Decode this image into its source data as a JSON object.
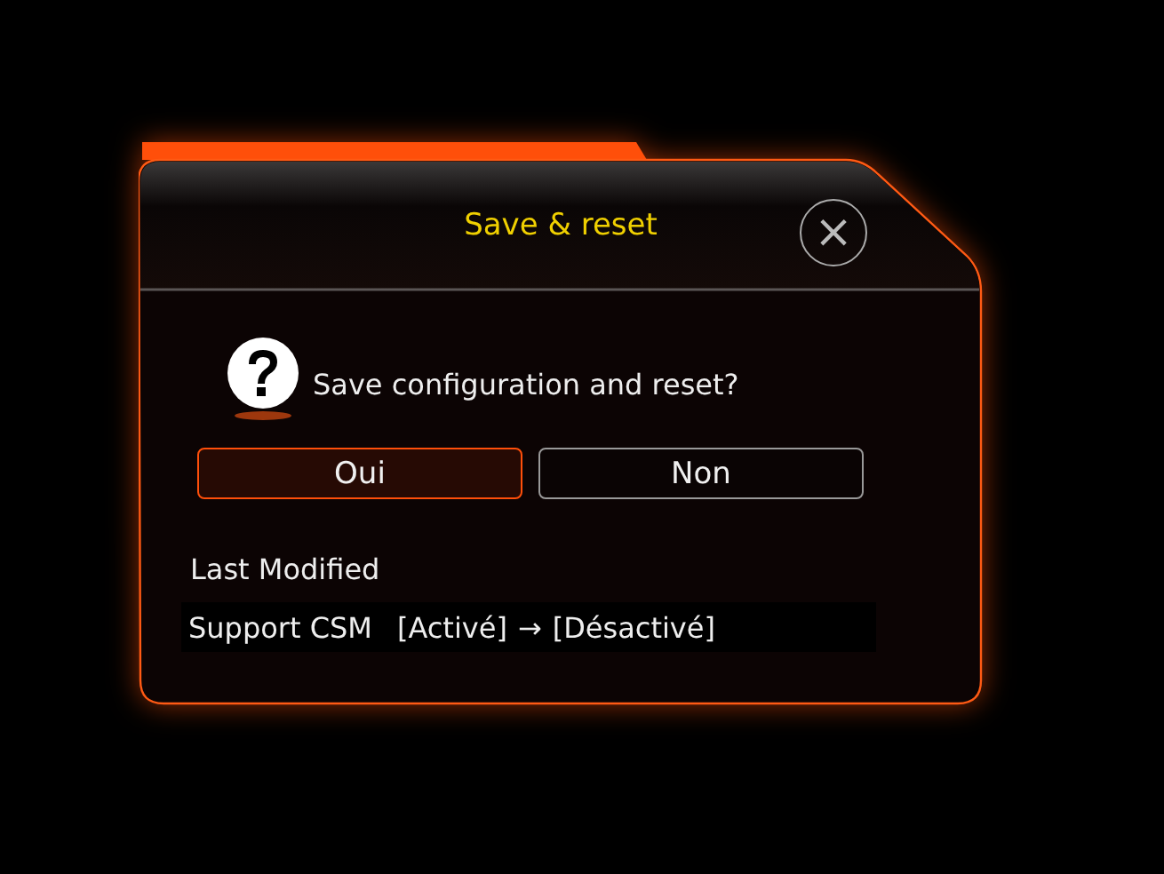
{
  "dialog": {
    "title": "Save & reset",
    "close": "×",
    "message": "Save configuration and reset?",
    "buttons": [
      {
        "label": "Oui",
        "selected": true
      },
      {
        "label": "Non",
        "selected": false
      }
    ],
    "last_modified": {
      "heading": "Last Modified",
      "changes": [
        {
          "name": "Support CSM",
          "from": "[Activé]",
          "arrow": "→",
          "to": "[Désactivé]"
        }
      ]
    }
  }
}
